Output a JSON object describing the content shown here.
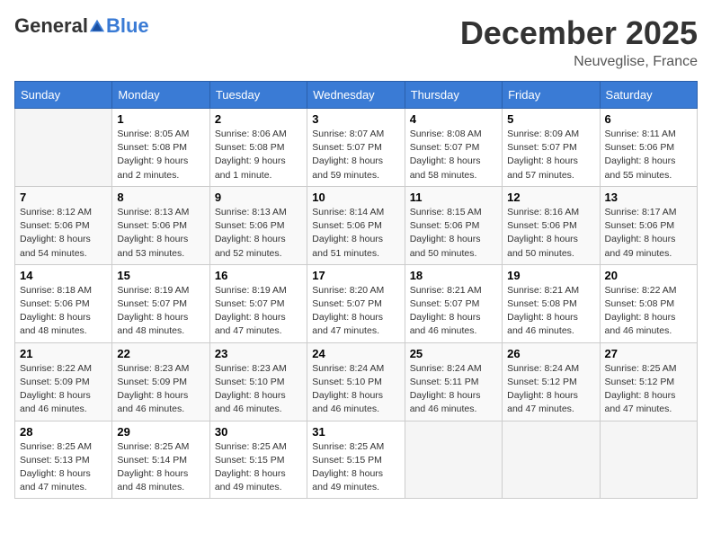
{
  "header": {
    "logo_general": "General",
    "logo_blue": "Blue",
    "title": "December 2025",
    "subtitle": "Neuveglise, France"
  },
  "days_of_week": [
    "Sunday",
    "Monday",
    "Tuesday",
    "Wednesday",
    "Thursday",
    "Friday",
    "Saturday"
  ],
  "weeks": [
    [
      {
        "day": "",
        "detail": ""
      },
      {
        "day": "1",
        "detail": "Sunrise: 8:05 AM\nSunset: 5:08 PM\nDaylight: 9 hours\nand 2 minutes."
      },
      {
        "day": "2",
        "detail": "Sunrise: 8:06 AM\nSunset: 5:08 PM\nDaylight: 9 hours\nand 1 minute."
      },
      {
        "day": "3",
        "detail": "Sunrise: 8:07 AM\nSunset: 5:07 PM\nDaylight: 8 hours\nand 59 minutes."
      },
      {
        "day": "4",
        "detail": "Sunrise: 8:08 AM\nSunset: 5:07 PM\nDaylight: 8 hours\nand 58 minutes."
      },
      {
        "day": "5",
        "detail": "Sunrise: 8:09 AM\nSunset: 5:07 PM\nDaylight: 8 hours\nand 57 minutes."
      },
      {
        "day": "6",
        "detail": "Sunrise: 8:11 AM\nSunset: 5:06 PM\nDaylight: 8 hours\nand 55 minutes."
      }
    ],
    [
      {
        "day": "7",
        "detail": "Sunrise: 8:12 AM\nSunset: 5:06 PM\nDaylight: 8 hours\nand 54 minutes."
      },
      {
        "day": "8",
        "detail": "Sunrise: 8:13 AM\nSunset: 5:06 PM\nDaylight: 8 hours\nand 53 minutes."
      },
      {
        "day": "9",
        "detail": "Sunrise: 8:13 AM\nSunset: 5:06 PM\nDaylight: 8 hours\nand 52 minutes."
      },
      {
        "day": "10",
        "detail": "Sunrise: 8:14 AM\nSunset: 5:06 PM\nDaylight: 8 hours\nand 51 minutes."
      },
      {
        "day": "11",
        "detail": "Sunrise: 8:15 AM\nSunset: 5:06 PM\nDaylight: 8 hours\nand 50 minutes."
      },
      {
        "day": "12",
        "detail": "Sunrise: 8:16 AM\nSunset: 5:06 PM\nDaylight: 8 hours\nand 50 minutes."
      },
      {
        "day": "13",
        "detail": "Sunrise: 8:17 AM\nSunset: 5:06 PM\nDaylight: 8 hours\nand 49 minutes."
      }
    ],
    [
      {
        "day": "14",
        "detail": "Sunrise: 8:18 AM\nSunset: 5:06 PM\nDaylight: 8 hours\nand 48 minutes."
      },
      {
        "day": "15",
        "detail": "Sunrise: 8:19 AM\nSunset: 5:07 PM\nDaylight: 8 hours\nand 48 minutes."
      },
      {
        "day": "16",
        "detail": "Sunrise: 8:19 AM\nSunset: 5:07 PM\nDaylight: 8 hours\nand 47 minutes."
      },
      {
        "day": "17",
        "detail": "Sunrise: 8:20 AM\nSunset: 5:07 PM\nDaylight: 8 hours\nand 47 minutes."
      },
      {
        "day": "18",
        "detail": "Sunrise: 8:21 AM\nSunset: 5:07 PM\nDaylight: 8 hours\nand 46 minutes."
      },
      {
        "day": "19",
        "detail": "Sunrise: 8:21 AM\nSunset: 5:08 PM\nDaylight: 8 hours\nand 46 minutes."
      },
      {
        "day": "20",
        "detail": "Sunrise: 8:22 AM\nSunset: 5:08 PM\nDaylight: 8 hours\nand 46 minutes."
      }
    ],
    [
      {
        "day": "21",
        "detail": "Sunrise: 8:22 AM\nSunset: 5:09 PM\nDaylight: 8 hours\nand 46 minutes."
      },
      {
        "day": "22",
        "detail": "Sunrise: 8:23 AM\nSunset: 5:09 PM\nDaylight: 8 hours\nand 46 minutes."
      },
      {
        "day": "23",
        "detail": "Sunrise: 8:23 AM\nSunset: 5:10 PM\nDaylight: 8 hours\nand 46 minutes."
      },
      {
        "day": "24",
        "detail": "Sunrise: 8:24 AM\nSunset: 5:10 PM\nDaylight: 8 hours\nand 46 minutes."
      },
      {
        "day": "25",
        "detail": "Sunrise: 8:24 AM\nSunset: 5:11 PM\nDaylight: 8 hours\nand 46 minutes."
      },
      {
        "day": "26",
        "detail": "Sunrise: 8:24 AM\nSunset: 5:12 PM\nDaylight: 8 hours\nand 47 minutes."
      },
      {
        "day": "27",
        "detail": "Sunrise: 8:25 AM\nSunset: 5:12 PM\nDaylight: 8 hours\nand 47 minutes."
      }
    ],
    [
      {
        "day": "28",
        "detail": "Sunrise: 8:25 AM\nSunset: 5:13 PM\nDaylight: 8 hours\nand 47 minutes."
      },
      {
        "day": "29",
        "detail": "Sunrise: 8:25 AM\nSunset: 5:14 PM\nDaylight: 8 hours\nand 48 minutes."
      },
      {
        "day": "30",
        "detail": "Sunrise: 8:25 AM\nSunset: 5:15 PM\nDaylight: 8 hours\nand 49 minutes."
      },
      {
        "day": "31",
        "detail": "Sunrise: 8:25 AM\nSunset: 5:15 PM\nDaylight: 8 hours\nand 49 minutes."
      },
      {
        "day": "",
        "detail": ""
      },
      {
        "day": "",
        "detail": ""
      },
      {
        "day": "",
        "detail": ""
      }
    ]
  ]
}
